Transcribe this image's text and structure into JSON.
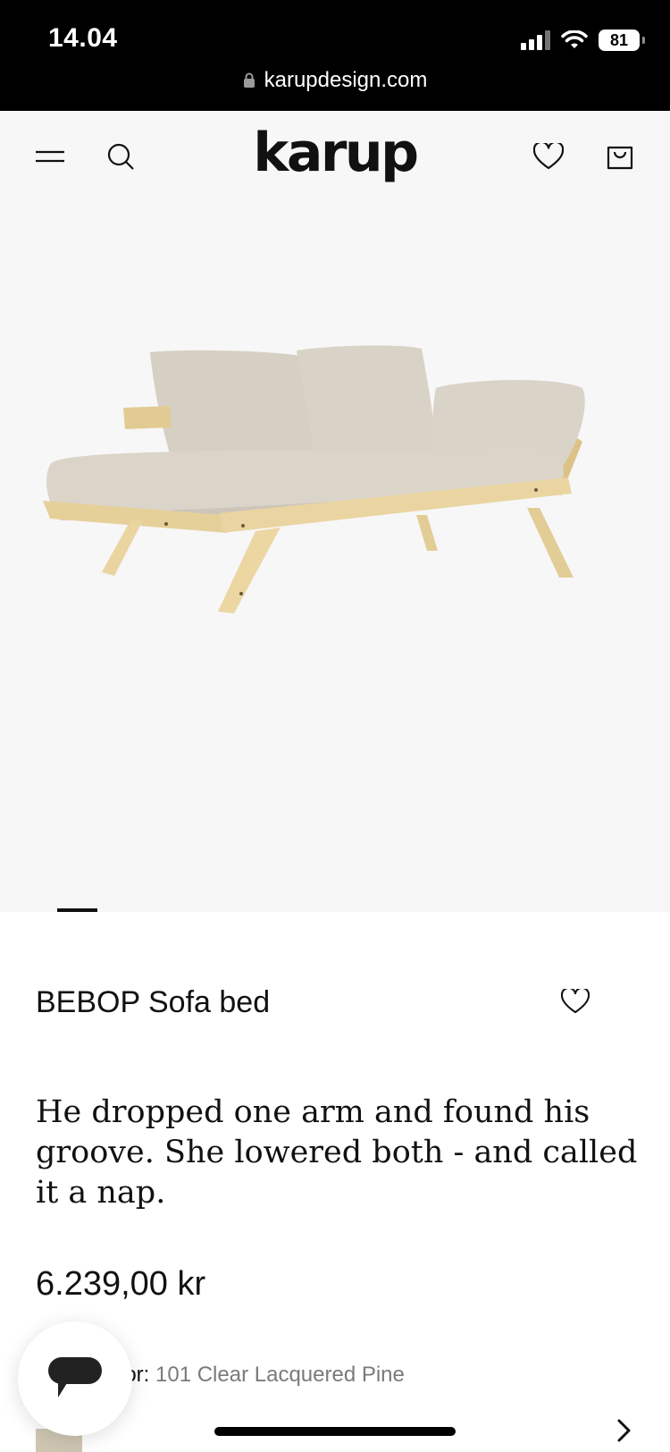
{
  "status_bar": {
    "time": "14.04",
    "battery": "81",
    "url": "karupdesign.com"
  },
  "header": {
    "logo": "karup",
    "menu_icon": "menu-icon",
    "search_icon": "search-icon",
    "wishlist_icon": "heart-icon",
    "cart_icon": "shopping-bag-icon"
  },
  "hero": {
    "image": "product-photo",
    "slide_indicator": {
      "current": 1
    }
  },
  "product": {
    "title": "BEBOP Sofa bed",
    "tagline": "He dropped one arm and found his groove. She lowered both - and called it a nap.",
    "price": "6.239,00 kr",
    "color_label": "lor:",
    "color_value": "101 Clear Lacquered Pine"
  },
  "colors": {
    "header_bg": "#f7f7f7",
    "hero_bg": "#f7f7f7",
    "text": "#111111",
    "muted": "#7a7a7a"
  }
}
